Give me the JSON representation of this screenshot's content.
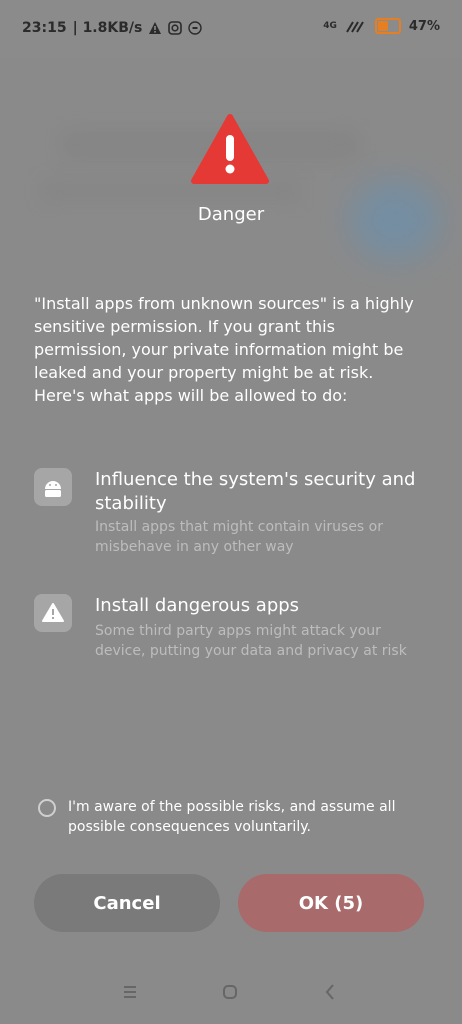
{
  "status_bar": {
    "time": "23:15",
    "speed": "| 1.8KB/s",
    "network": "4G",
    "battery": "47%",
    "battery_level": 0.47
  },
  "dialog": {
    "title": "Danger",
    "description": "\"Install apps from unknown sources\" is a highly sensitive permission. If you grant this permission, your private information might be leaked and your property might be at risk. Here's what apps will be allowed to do:",
    "permissions": [
      {
        "title": "Influence the system's security and stability",
        "subtitle": "Install apps that might contain viruses or misbehave in any other way",
        "icon": "android-icon"
      },
      {
        "title": "Install dangerous apps",
        "subtitle": "Some third party apps might attack your device, putting your data and privacy at risk",
        "icon": "warning-icon"
      }
    ],
    "aware_text": "I'm aware of the possible risks, and assume all possible consequences voluntarily.",
    "cancel_label": "Cancel",
    "ok_label": "OK (5)"
  },
  "colors": {
    "warning_red": "#e53935",
    "ok_button": "#a86a6a",
    "cancel_button": "#7a7a7a"
  }
}
